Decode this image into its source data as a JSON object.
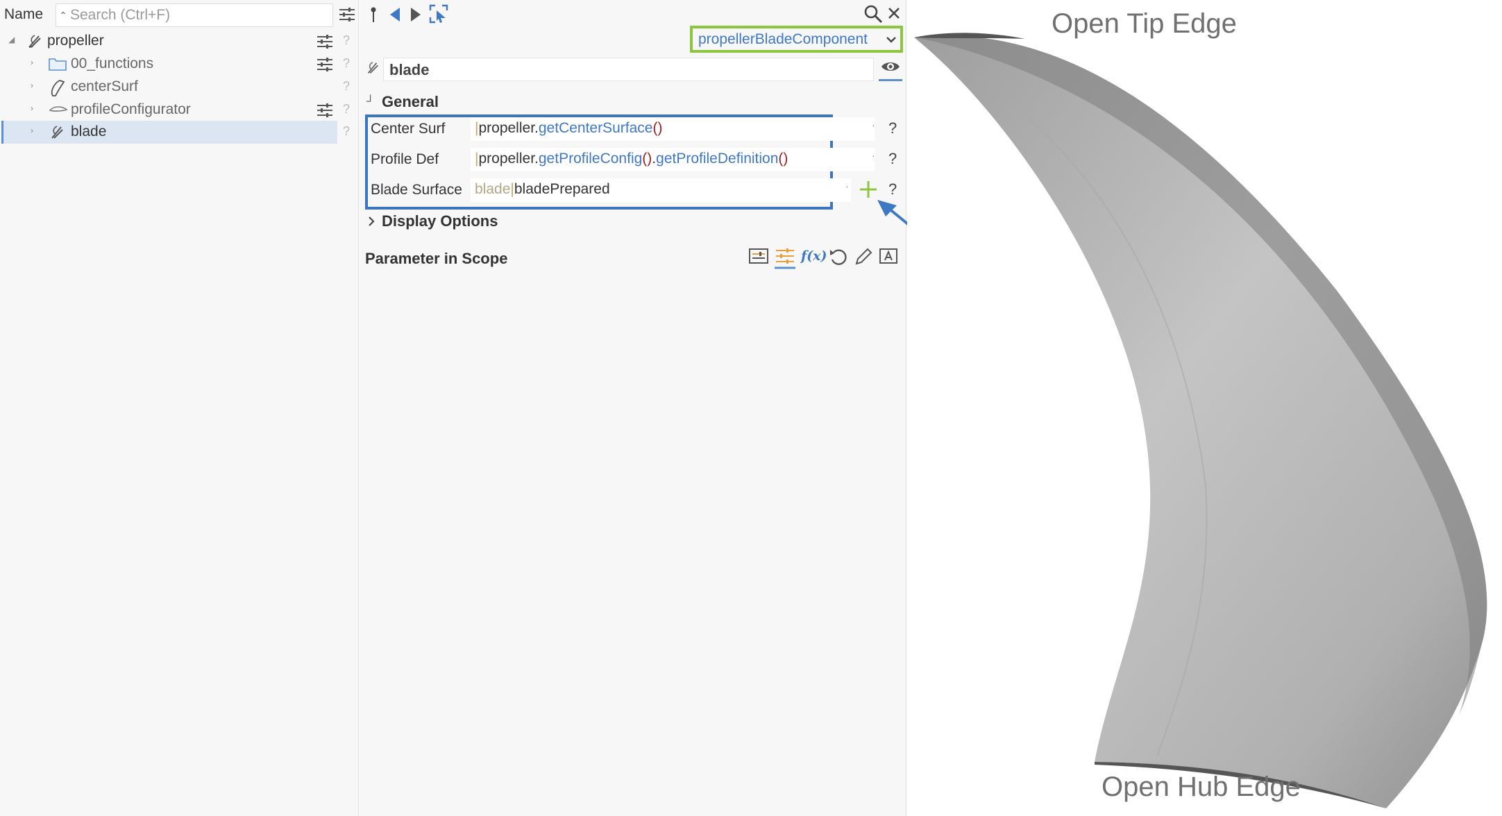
{
  "tree": {
    "column_header": "Name",
    "search_placeholder": "Search (Ctrl+F)",
    "items": [
      {
        "label": "propeller",
        "icon": "script-pen-icon",
        "expander": "expanded"
      },
      {
        "label": "00_functions",
        "icon": "folder-icon",
        "expander": "collapsed"
      },
      {
        "label": "centerSurf",
        "icon": "surface-icon",
        "expander": "collapsed"
      },
      {
        "label": "profileConfigurator",
        "icon": "profile-icon",
        "expander": "collapsed"
      },
      {
        "label": "blade",
        "icon": "blade-icon",
        "expander": "collapsed",
        "selected": true
      }
    ],
    "help_glyph": "?"
  },
  "properties": {
    "component_type": "propellerBladeComponent",
    "object_name": "blade",
    "general_section": "General",
    "params": [
      {
        "label": "Center Surf",
        "bar": "|",
        "parts": [
          "propeller",
          ".",
          "getCenterSurface",
          "()"
        ]
      },
      {
        "label": "Profile Def",
        "bar": "|",
        "parts": [
          "propeller",
          ".",
          "getProfileConfig",
          "()",
          ".",
          "getProfileDefinition",
          "()"
        ]
      },
      {
        "label": "Blade Surface",
        "ghost": "blade",
        "bar": "|",
        "value": "bladePrepared"
      }
    ],
    "display_options": "Display Options",
    "scope_title": "Parameter in Scope",
    "fx_label": "f(x)",
    "help_glyph": "?",
    "dot_glyph": "·"
  },
  "viewport": {
    "tip_label": "Open Tip Edge",
    "hub_label": "Open Hub Edge"
  },
  "colors": {
    "accent_blue": "#3c74c0",
    "highlight_green": "#8cc63f",
    "selection_bg": "#dce6f2"
  }
}
